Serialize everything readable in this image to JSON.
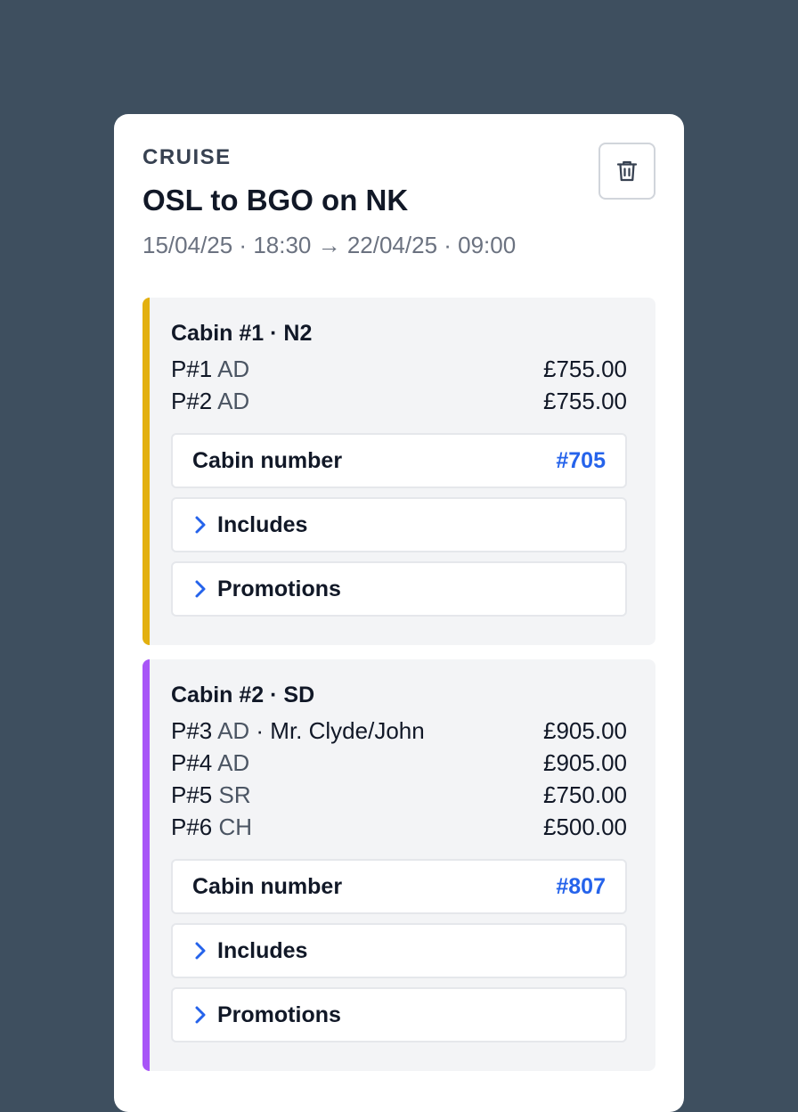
{
  "booking": {
    "category": "CRUISE",
    "title": "OSL to BGO on NK",
    "dates": "15/04/25 · 18:30 → 22/04/25 · 09:00"
  },
  "icons": {
    "delete": "trash-icon",
    "expand": "chevron-right-icon"
  },
  "colors": {
    "background": "#3e4f5f",
    "accent_link": "#2563eb",
    "cabin1_bar": "#e3b00f",
    "cabin2_bar": "#a855f7"
  },
  "cabins": [
    {
      "title": "Cabin #1 · N2",
      "passengers": [
        {
          "id": "P#1",
          "type": "AD",
          "name": "",
          "price": "£755.00"
        },
        {
          "id": "P#2",
          "type": "AD",
          "name": "",
          "price": "£755.00"
        }
      ],
      "cabin_number_label": "Cabin number",
      "cabin_number": "#705",
      "includes_label": "Includes",
      "promotions_label": "Promotions"
    },
    {
      "title": "Cabin #2 · SD",
      "passengers": [
        {
          "id": "P#3",
          "type": "AD",
          "name": " · Mr. Clyde/John",
          "price": "£905.00"
        },
        {
          "id": "P#4",
          "type": "AD",
          "name": "",
          "price": "£905.00"
        },
        {
          "id": "P#5",
          "type": "SR",
          "name": "",
          "price": "£750.00"
        },
        {
          "id": "P#6",
          "type": "CH",
          "name": "",
          "price": "£500.00"
        }
      ],
      "cabin_number_label": "Cabin number",
      "cabin_number": "#807",
      "includes_label": "Includes",
      "promotions_label": "Promotions"
    }
  ]
}
